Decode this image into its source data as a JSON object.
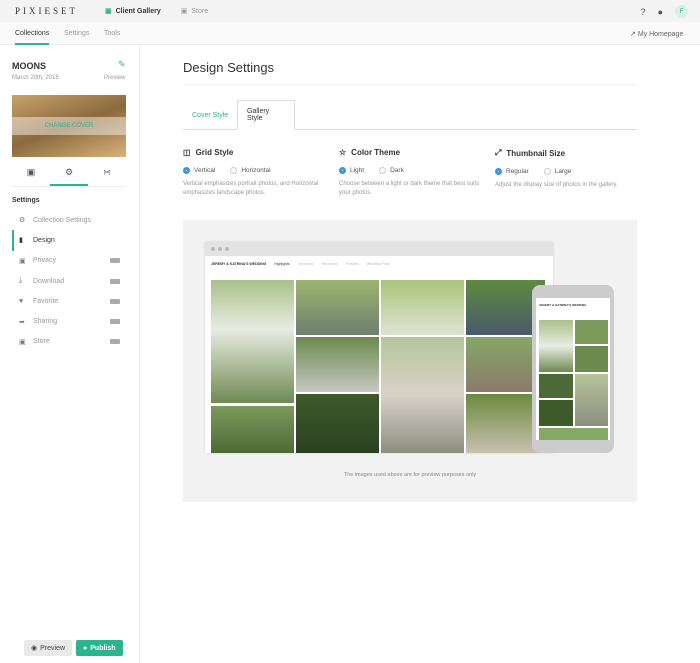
{
  "topbar": {
    "logo": "PIXIESET",
    "nav": [
      {
        "label": "Client Gallery",
        "icon": "camera-icon"
      },
      {
        "label": "Store",
        "icon": "cart-icon"
      }
    ],
    "right": {
      "help": "?",
      "bell": "bell-icon",
      "avatar": "F"
    }
  },
  "subnav": {
    "tabs": [
      "Collections",
      "Settings",
      "Tools"
    ],
    "active": "Collections",
    "homepage": "My Homepage"
  },
  "collection": {
    "name": "MOONS",
    "date": "March 20th, 2018",
    "preview": "Preview",
    "change_cover": "CHANGE COVER"
  },
  "sidebar": {
    "heading": "Settings",
    "items": [
      {
        "label": "Collection Settings",
        "icon": "gear-icon",
        "badge": ""
      },
      {
        "label": "Design",
        "icon": "bookmark-icon",
        "badge": ""
      },
      {
        "label": "Privacy",
        "icon": "lock-icon",
        "badge": "off"
      },
      {
        "label": "Download",
        "icon": "download-icon",
        "badge": "on"
      },
      {
        "label": "Favorite",
        "icon": "heart-icon",
        "badge": "on"
      },
      {
        "label": "Sharing",
        "icon": "share-icon",
        "badge": "on"
      },
      {
        "label": "Store",
        "icon": "cart-icon",
        "badge": "off"
      }
    ],
    "active": "Design"
  },
  "buttons": {
    "preview": "Preview",
    "publish": "Publish"
  },
  "main": {
    "title": "Design Settings",
    "tabs": [
      "Cover Style",
      "Gallery Style"
    ],
    "active_tab": "Gallery Style",
    "options": [
      {
        "title": "Grid Style",
        "choices": [
          "Vertical",
          "Horizontal"
        ],
        "selected": "Vertical",
        "desc": "Vertical emphasizes portrait photos, and Horizontal emphasizes landscape photos."
      },
      {
        "title": "Color Theme",
        "choices": [
          "Light",
          "Dark"
        ],
        "selected": "Light",
        "desc": "Choose between a light or dark theme that best suits your photos."
      },
      {
        "title": "Thumbnail Size",
        "choices": [
          "Regular",
          "Large"
        ],
        "selected": "Regular",
        "desc": "Adjust the display size of photos in the gallery."
      }
    ],
    "preview": {
      "gallery_title": "JEREMY & KATRINA'S WEDDING",
      "nav": [
        "Highlights",
        "Ceremony",
        "Reception",
        "Portraits",
        "Wedding Party"
      ],
      "note": "The images used above are for preview purposes only"
    }
  },
  "colors": {
    "accent": "#2bb48e",
    "radio": "#3d8fe0"
  }
}
